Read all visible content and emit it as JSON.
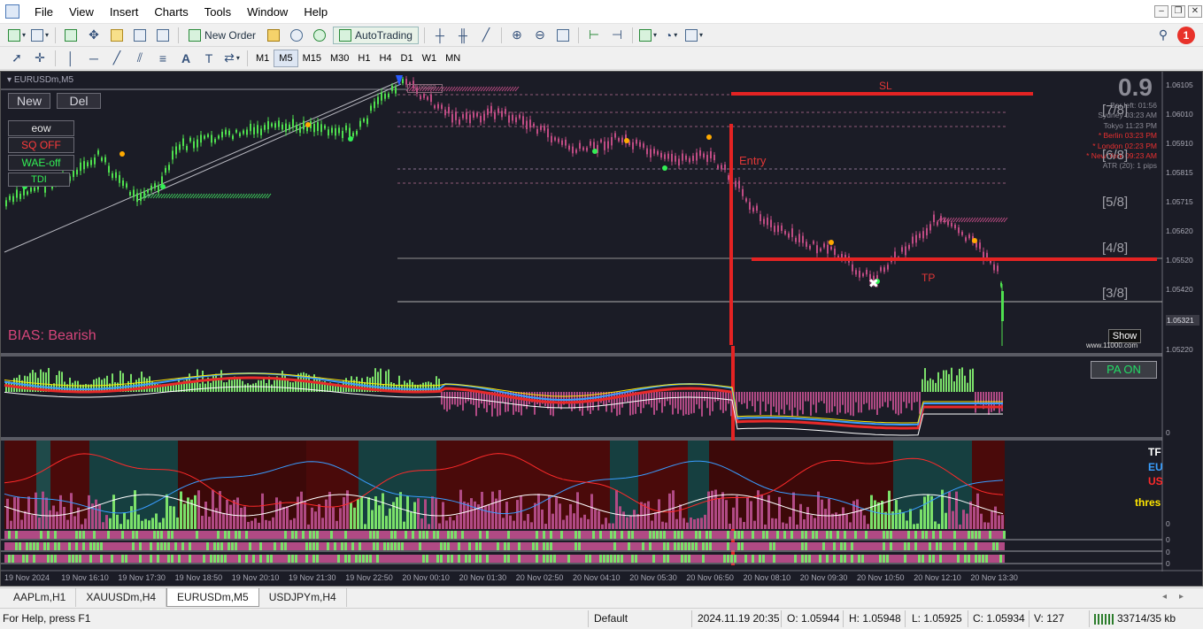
{
  "menu": [
    "File",
    "View",
    "Insert",
    "Charts",
    "Tools",
    "Window",
    "Help"
  ],
  "toolbar": {
    "new_order": "New Order",
    "autotrading": "AutoTrading",
    "notification_count": "1"
  },
  "timeframes": [
    "M1",
    "M5",
    "M15",
    "M30",
    "H1",
    "H4",
    "D1",
    "W1",
    "MN"
  ],
  "active_timeframe": "M5",
  "chart": {
    "title": "EURUSDm,M5",
    "new_label": "New",
    "del_label": "Del",
    "side_buttons": [
      {
        "label": "eow",
        "color": "#e8e8e8"
      },
      {
        "label": "SQ OFF",
        "color": "#ff3b3b"
      },
      {
        "label": "WAE-off",
        "color": "#33ee55"
      },
      {
        "label": "TDI",
        "color": "#33ee55"
      }
    ],
    "bias": "BIAS: Bearish",
    "big_number": "0.9",
    "clock_lines": [
      {
        "text": "Bar left: 01:56",
        "red": false
      },
      {
        "text": "Sydney 03:23 AM",
        "red": false
      },
      {
        "text": "Tokyo 11:23 PM",
        "red": false
      },
      {
        "text": "* Berlin 03:23 PM",
        "red": true
      },
      {
        "text": "* London 02:23 PM",
        "red": true
      },
      {
        "text": "* New York 09:23 AM",
        "red": true
      },
      {
        "text": "ATR (20): 1 pips",
        "red": false
      }
    ],
    "pa_on": "PA ON",
    "show": "Show",
    "watermark": "www.11000.com",
    "sl_label": "SL",
    "entry_label": "Entry",
    "tp_label": "TP",
    "top_price_tag": "1.06093",
    "murray_levels": [
      "[7/8]",
      "[6/8]",
      "[5/8]",
      "[4/8]",
      "[3/8]"
    ],
    "price_ticks": [
      "1.06105",
      "1.06010",
      "1.05910",
      "1.05815",
      "1.05715",
      "1.05620",
      "1.05520",
      "1.05420",
      "1.05220"
    ],
    "current_price": "1.05321",
    "sub1_zero": "0",
    "sub2_labels": [
      "0",
      "0",
      "0",
      "0"
    ],
    "legend": [
      {
        "text": "TF",
        "color": "#ffffff"
      },
      {
        "text": "EU",
        "color": "#3aa0ff"
      },
      {
        "text": "US",
        "color": "#ff2a2a"
      },
      {
        "text": "thres",
        "color": "#ffe600"
      }
    ],
    "time_labels": [
      "19 Nov 2024",
      "19 Nov 16:10",
      "19 Nov 17:30",
      "19 Nov 18:50",
      "19 Nov 20:10",
      "19 Nov 21:30",
      "19 Nov 22:50",
      "20 Nov 00:10",
      "20 Nov 01:30",
      "20 Nov 02:50",
      "20 Nov 04:10",
      "20 Nov 05:30",
      "20 Nov 06:50",
      "20 Nov 08:10",
      "20 Nov 09:30",
      "20 Nov 10:50",
      "20 Nov 12:10",
      "20 Nov 13:30"
    ]
  },
  "tabs": [
    "AAPLm,H1",
    "XAUUSDm,H4",
    "EURUSDm,M5",
    "USDJPYm,H4"
  ],
  "active_tab": "EURUSDm,M5",
  "status": {
    "help": "For Help, press F1",
    "profile": "Default",
    "datetime": "2024.11.19 20:35",
    "open": "O: 1.05944",
    "high": "H: 1.05948",
    "low": "L: 1.05925",
    "close": "C: 1.05934",
    "volume": "V: 127",
    "traffic": "33714/35 kb"
  }
}
